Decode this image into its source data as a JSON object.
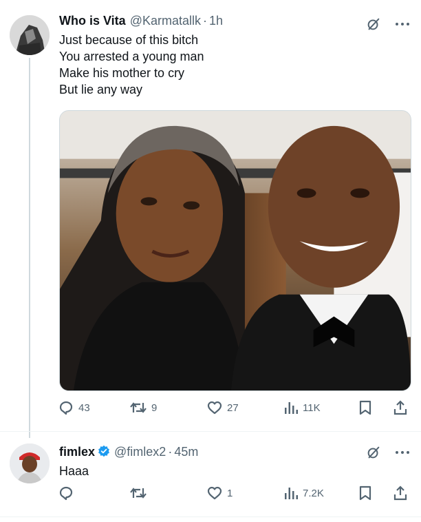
{
  "tweet1": {
    "author_name": "Who is Vita",
    "handle": "@Karmatallk",
    "separator": "·",
    "time": "1h",
    "text_lines": [
      "Just because of this bitch",
      "You arrested a young man",
      "Make his mother to cry",
      "But lie any way"
    ],
    "stats": {
      "replies": "43",
      "retweets": "9",
      "likes": "27",
      "views": "11K"
    }
  },
  "tweet2": {
    "author_name": "fimlex",
    "handle": "@fimlex2",
    "separator": "·",
    "time": "45m",
    "text": "Haaa",
    "stats": {
      "replies": "",
      "retweets": "",
      "likes": "1",
      "views": "7.2K"
    }
  },
  "colors": {
    "text_primary": "#0f1419",
    "text_secondary": "#536471",
    "verified_blue": "#1d9bf0",
    "thread_line": "#cfd9de"
  },
  "icons": [
    "grok-icon",
    "more-icon",
    "reply-icon",
    "retweet-icon",
    "like-icon",
    "views-icon",
    "bookmark-icon",
    "share-icon",
    "verified-badge-icon"
  ]
}
